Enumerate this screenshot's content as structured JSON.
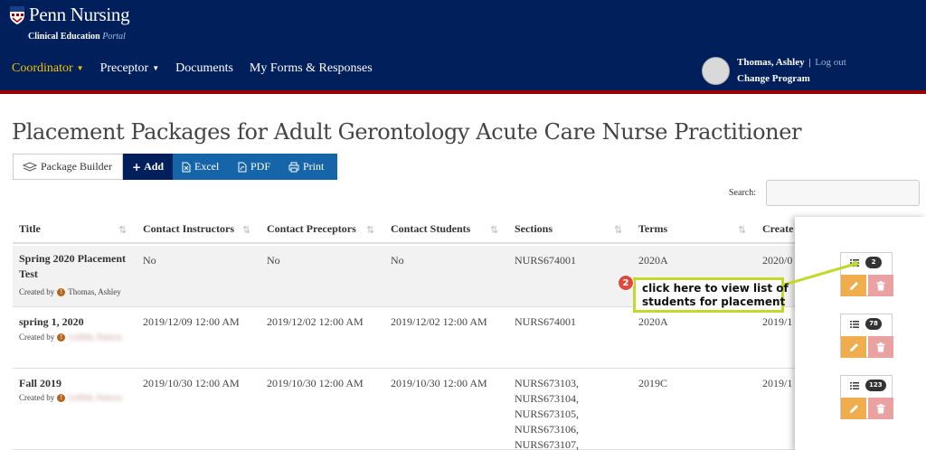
{
  "brand": {
    "name": "Penn Nursing",
    "subtitle": "Clinical Education",
    "subtitle_em": "Portal"
  },
  "nav": {
    "items": [
      {
        "label": "Coordinator",
        "dropdown": true,
        "active": true
      },
      {
        "label": "Preceptor",
        "dropdown": true,
        "active": false
      },
      {
        "label": "Documents",
        "dropdown": false,
        "active": false
      },
      {
        "label": "My Forms & Responses",
        "dropdown": false,
        "active": false
      }
    ]
  },
  "user": {
    "name": "Thomas, Ashley",
    "separator": "|",
    "logout": "Log out",
    "change_program": "Change Program"
  },
  "page": {
    "title": "Placement Packages for Adult Gerontology Acute Care Nurse Practitioner"
  },
  "toolbar": {
    "builder": "Package Builder",
    "add": "Add",
    "excel": "Excel",
    "pdf": "PDF",
    "print": "Print"
  },
  "search": {
    "label": "Search:",
    "value": ""
  },
  "table": {
    "headers": [
      "Title",
      "Contact Instructors",
      "Contact Preceptors",
      "Contact Students",
      "Sections",
      "Terms",
      "Create"
    ],
    "created_by_label": "Created by",
    "rows": [
      {
        "title": "Spring 2020 Placement Test",
        "created_by": "Thomas, Ashley",
        "contact_instructors": "No",
        "contact_preceptors": "No",
        "contact_students": "No",
        "sections": "NURS674001",
        "terms": "2020A",
        "created": "2020/0",
        "student_count": "2"
      },
      {
        "title": "spring 1, 2020",
        "created_by": "Griffith, Patricia",
        "contact_instructors": "2019/12/09 12:00 AM",
        "contact_preceptors": "2019/12/02 12:00 AM",
        "contact_students": "2019/12/02 12:00 AM",
        "sections": "NURS674001",
        "terms": "2020A",
        "created": "2019/1",
        "student_count": "78"
      },
      {
        "title": "Fall 2019",
        "created_by": "Griffith, Patricia",
        "contact_instructors": "2019/10/30 12:00 AM",
        "contact_preceptors": "2019/10/30 12:00 AM",
        "contact_students": "2019/10/30 12:00 AM",
        "sections": "NURS673103,\nNURS673104,\nNURS673105,\nNURS673106,\nNURS673107,",
        "terms": "2019C",
        "created": "2019/1",
        "student_count": "123"
      }
    ]
  },
  "callout": {
    "step": "2",
    "line1": "click here to view list of",
    "line2": "students for placement"
  },
  "colors": {
    "header_bg": "#011f5b",
    "accent_red": "#990000",
    "nav_active": "#f2c200",
    "button_blue": "#1565a8",
    "edit_orange": "#f0ad4e",
    "delete_pink": "#e9a1a1",
    "callout_border": "#c2d82a"
  }
}
